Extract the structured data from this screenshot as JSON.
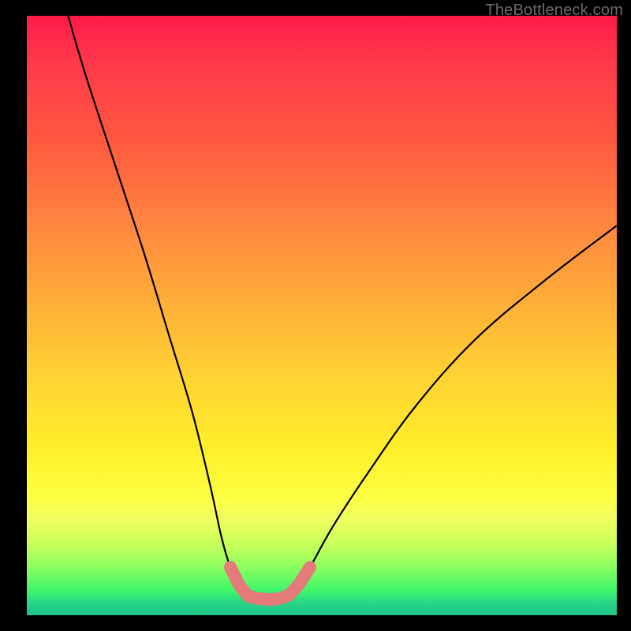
{
  "watermark": "TheBottleneck.com",
  "colors": {
    "frame": "#000000",
    "curve": "#000000",
    "highlight": "#e47a7a",
    "gradient_top": "#ff1a4a",
    "gradient_bottom": "#1ec488"
  },
  "chart_data": {
    "type": "line",
    "title": "",
    "xlabel": "",
    "ylabel": "",
    "xlim": [
      0,
      100
    ],
    "ylim": [
      0,
      100
    ],
    "grid": false,
    "legend": false,
    "series": [
      {
        "name": "bottleneck-curve",
        "x": [
          7,
          10,
          15,
          20,
          24,
          28,
          31,
          33,
          34.5,
          36,
          37.5,
          39,
          41,
          43,
          44.5,
          46,
          48,
          52,
          58,
          66,
          76,
          88,
          100
        ],
        "y": [
          100,
          90,
          75,
          60,
          47,
          34,
          22,
          13,
          8,
          5,
          3.2,
          2.8,
          2.6,
          2.8,
          3.4,
          5,
          8,
          15,
          24,
          35,
          46,
          56,
          65
        ]
      }
    ],
    "annotations": [
      {
        "name": "trough-highlight",
        "type": "polyline",
        "x": [
          34.5,
          36,
          37.5,
          39,
          41,
          43,
          44.5,
          46,
          48
        ],
        "y": [
          8,
          5,
          3.2,
          2.8,
          2.6,
          2.8,
          3.4,
          5,
          8
        ]
      }
    ]
  }
}
